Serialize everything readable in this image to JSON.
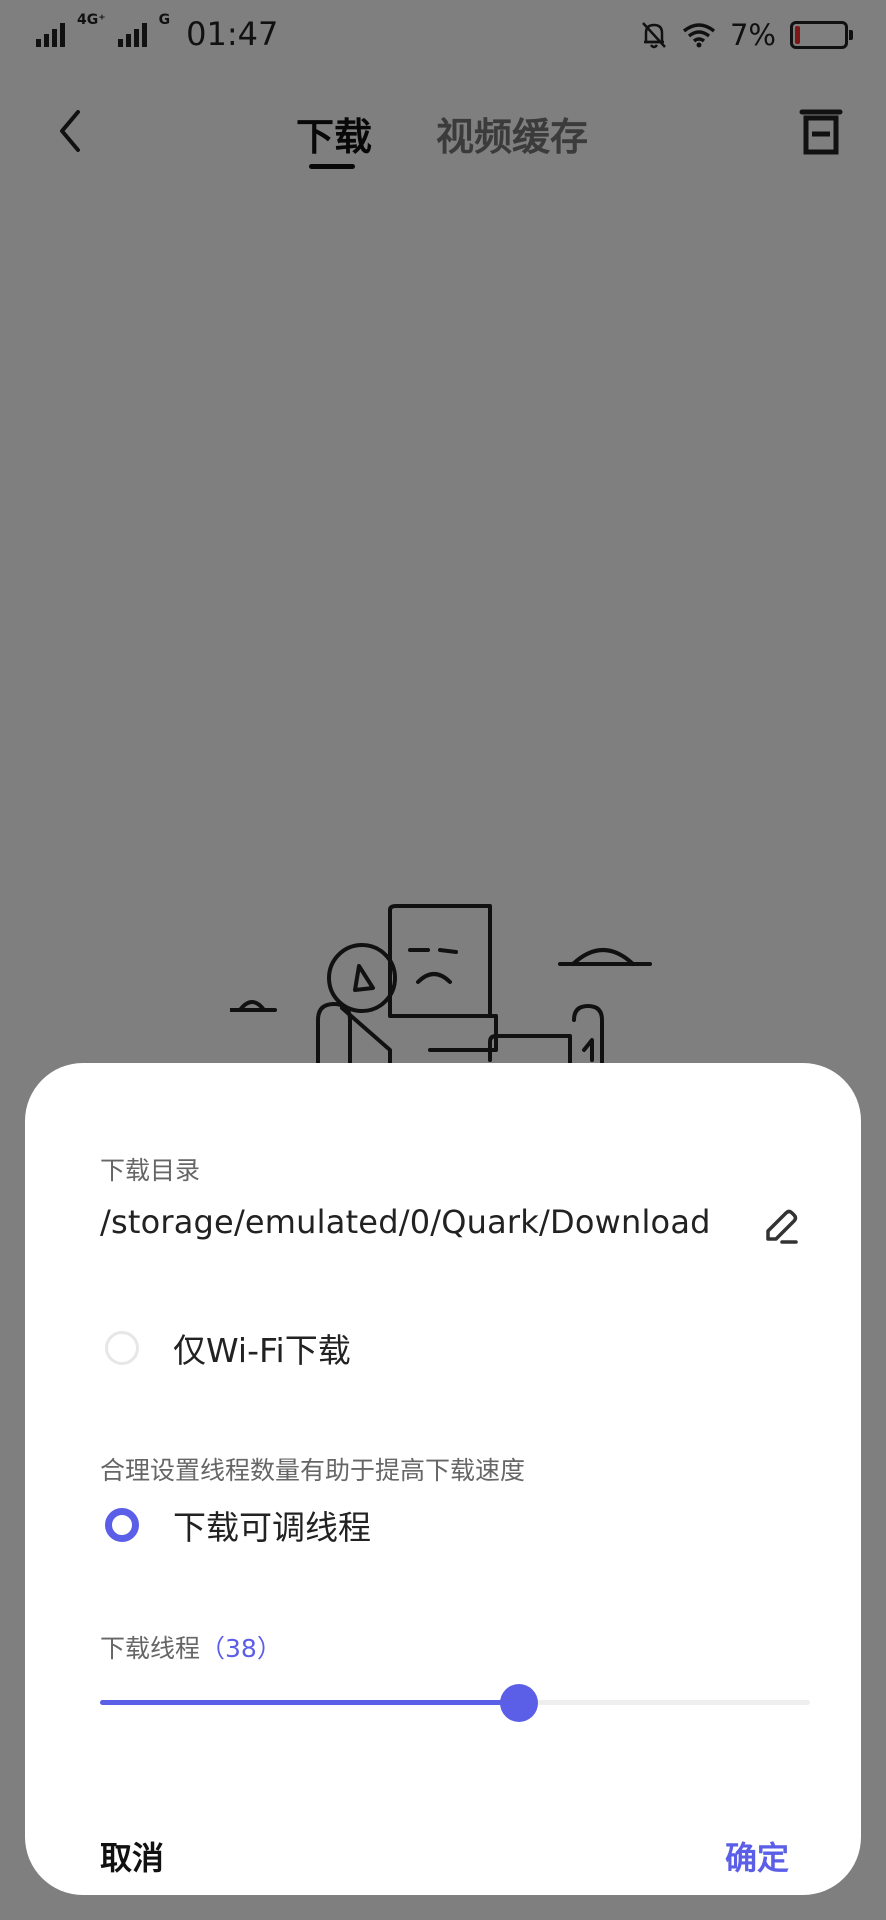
{
  "status_bar": {
    "network_1": "4G⁺",
    "network_2": "G",
    "time": "01:47",
    "battery_percent": "7%",
    "battery_level": 0.07,
    "icons": [
      "signal-icon",
      "mute-bell-icon",
      "wifi-icon",
      "battery-icon"
    ]
  },
  "header": {
    "tabs": [
      {
        "label": "下载",
        "active": true
      },
      {
        "label": "视频缓存",
        "active": false
      }
    ],
    "icons": [
      "back-icon",
      "trash-icon"
    ]
  },
  "dialog": {
    "dir_label": "下载目录",
    "dir_path": "/storage/emulated/0/Quark/Download",
    "wifi_only_label": "仅Wi-Fi下载",
    "wifi_only_checked": false,
    "thread_hint": "合理设置线程数量有助于提高下载速度",
    "adjustable_label": "下载可调线程",
    "adjustable_checked": true,
    "thread_label": "下载线程",
    "thread_count_text": "（38）",
    "thread_slider_fraction": 0.59,
    "cancel_label": "取消",
    "ok_label": "确定"
  },
  "colors": {
    "accent": "#5b5ee6",
    "overlay": "rgba(0,0,0,0.5)",
    "battery_low": "#ff2d2d"
  }
}
